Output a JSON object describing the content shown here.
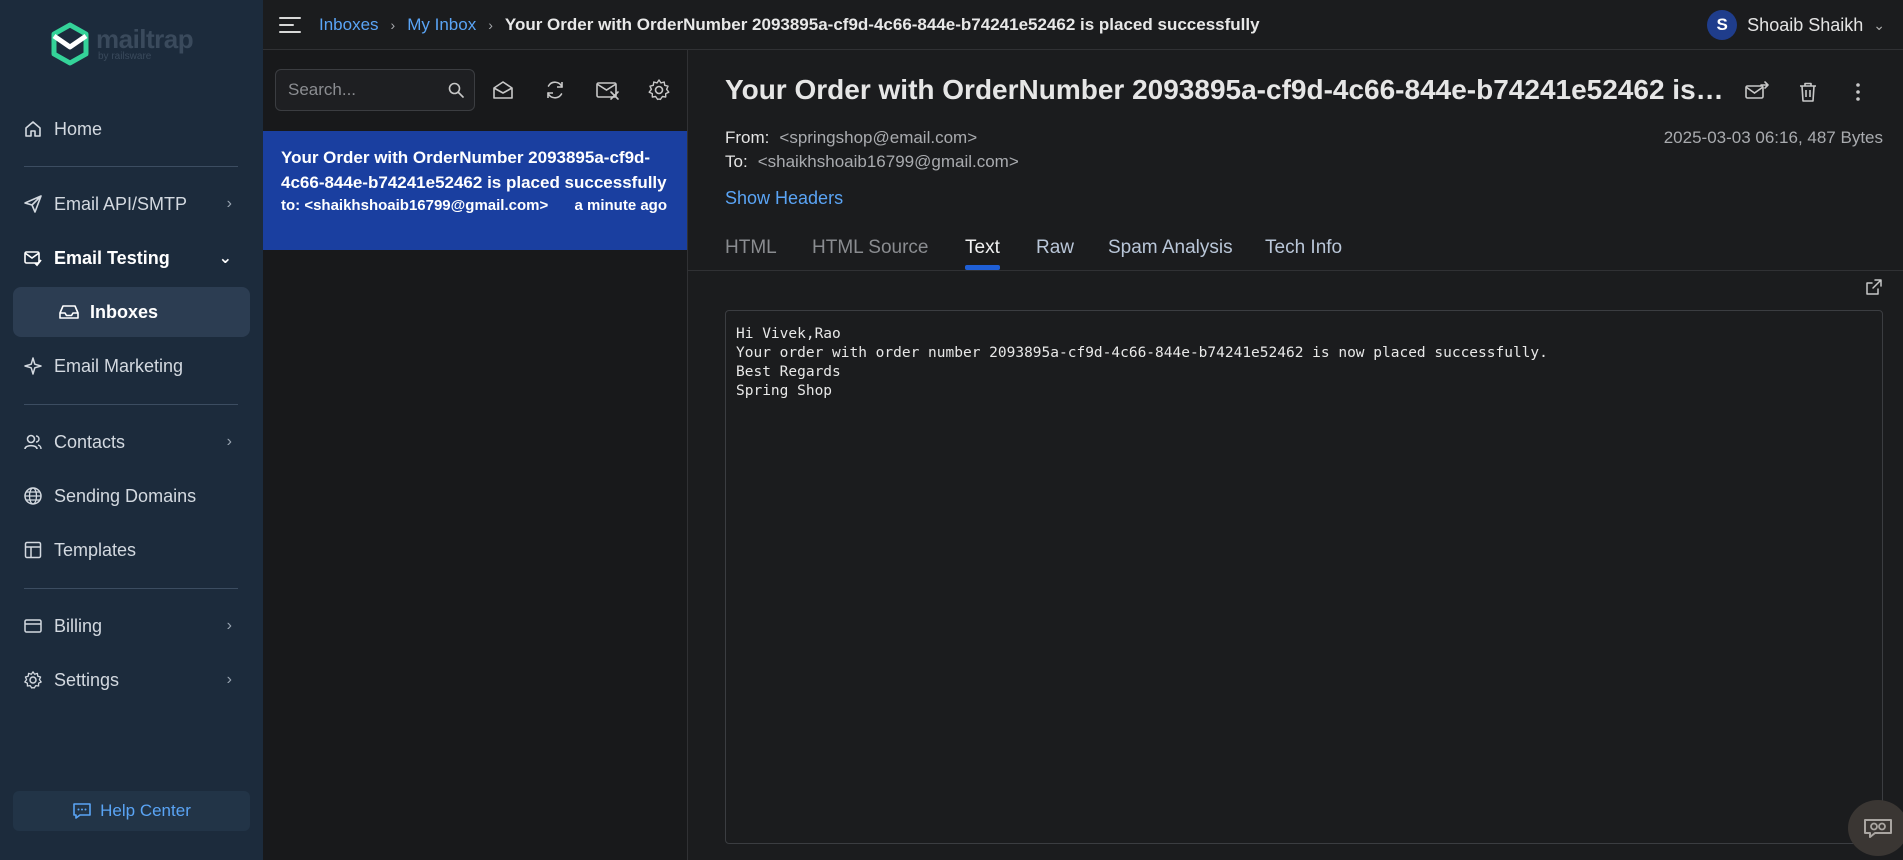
{
  "brand": {
    "name": "mailtrap",
    "sub": "by railsware",
    "accent": "#34d399"
  },
  "sidebar": {
    "items": [
      {
        "id": "home",
        "label": "Home",
        "icon": "home-icon"
      },
      {
        "id": "email-api",
        "label": "Email API/SMTP",
        "icon": "send-icon"
      },
      {
        "id": "email-testing",
        "label": "Email Testing",
        "icon": "testing-icon"
      },
      {
        "id": "inboxes",
        "label": "Inboxes",
        "icon": "inbox-icon"
      },
      {
        "id": "email-marketing",
        "label": "Email Marketing",
        "icon": "sparkle-icon"
      },
      {
        "id": "contacts",
        "label": "Contacts",
        "icon": "contacts-icon"
      },
      {
        "id": "sending-domains",
        "label": "Sending Domains",
        "icon": "globe-icon"
      },
      {
        "id": "templates",
        "label": "Templates",
        "icon": "templates-icon"
      },
      {
        "id": "billing",
        "label": "Billing",
        "icon": "billing-icon"
      },
      {
        "id": "settings",
        "label": "Settings",
        "icon": "gear-icon"
      }
    ],
    "help": "Help Center"
  },
  "topbar": {
    "breadcrumb": [
      "Inboxes",
      "My Inbox",
      "Your Order with OrderNumber 2093895a-cf9d-4c66-844e-b74241e52462 is placed successfully"
    ],
    "user_initial": "S",
    "user_name": "Shoaib Shaikh"
  },
  "list": {
    "search_placeholder": "Search...",
    "messages": [
      {
        "subject": "Your Order with OrderNumber 2093895a-cf9d-4c66-844e-b74241e52462 is placed successfully",
        "to": "to: <shaikhshoaib16799@gmail.com>",
        "time": "a minute ago"
      }
    ]
  },
  "message": {
    "subject": "Your Order with OrderNumber 2093895a-cf9d-4c66-844e-b74241e52462 is placed successfully",
    "from_label": "From:",
    "from": "<springshop@email.com>",
    "to_label": "To:",
    "to": "<shaikhshoaib16799@gmail.com>",
    "meta": "2025-03-03 06:16, 487 Bytes",
    "show_headers": "Show Headers",
    "tabs": [
      "HTML",
      "HTML Source",
      "Text",
      "Raw",
      "Spam Analysis",
      "Tech Info"
    ],
    "active_tab": "Text",
    "body_lines": [
      "Hi Vivek,Rao",
      "",
      "Your order with order number 2093895a-cf9d-4c66-844e-b74241e52462 is now placed successfully.",
      "",
      "Best Regards",
      "Spring Shop"
    ]
  }
}
